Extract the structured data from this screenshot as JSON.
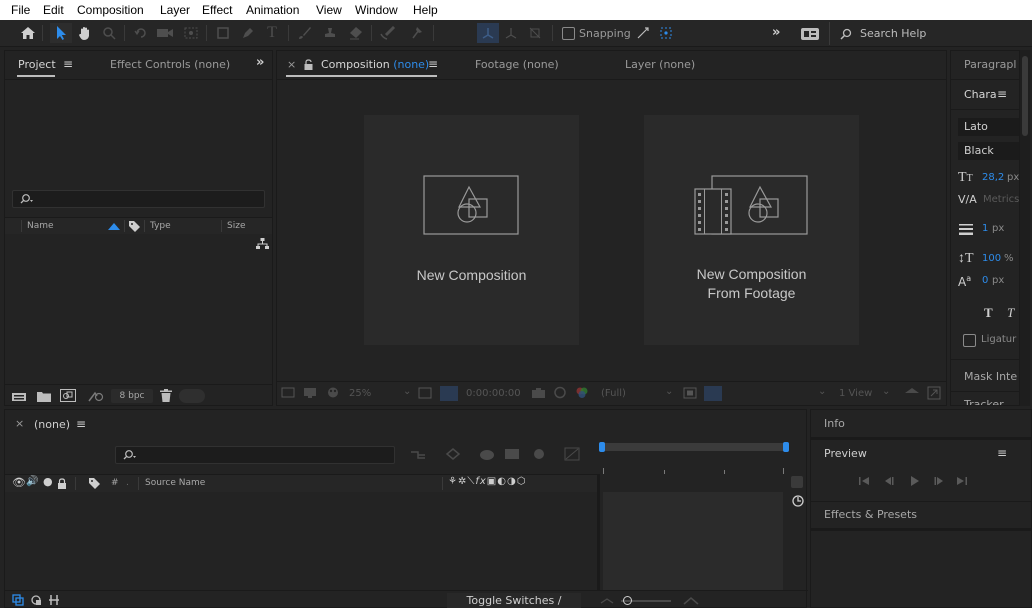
{
  "menu": [
    "File",
    "Edit",
    "Composition",
    "Layer",
    "Effect",
    "Animation",
    "View",
    "Window",
    "Help"
  ],
  "toolbar": {
    "snapping_label": "Snapping",
    "search_placeholder": "Search Help"
  },
  "project_panel": {
    "tab_project": "Project",
    "tab_effect_controls": "Effect Controls (none)",
    "columns": [
      "Name",
      "Type",
      "Size"
    ],
    "bpc": "8 bpc"
  },
  "viewer": {
    "tab_composition": "Composition",
    "tab_composition_value": "(none)",
    "tab_footage": "Footage (none)",
    "tab_layer": "Layer (none)",
    "card_new_comp": "New Composition",
    "card_from_footage_line1": "New Composition",
    "card_from_footage_line2": "From Footage",
    "zoom": "25%",
    "timecode": "0:00:00:00",
    "resolution": "(Full)",
    "views": "1 View"
  },
  "character_panel": {
    "tab_paragraph": "Paragrapl",
    "tab_character": "Chara",
    "font_family": "Lato",
    "font_style": "Black",
    "font_size": "28,2",
    "font_size_unit": "px",
    "kerning": "Metrics",
    "stroke_width": "1",
    "stroke_unit": "px",
    "vert_scale": "100",
    "vert_scale_unit": "%",
    "baseline_shift": "0",
    "baseline_unit": "px",
    "ligatures": "Ligatur",
    "mask_interp": "Mask Inte",
    "tracker": "Tracker"
  },
  "timeline": {
    "tab_label": "(none)",
    "col_source_name": "Source Name",
    "col_hash": "#",
    "toggle_label": "Toggle Switches / Modes"
  },
  "right_panels": {
    "info": "Info",
    "preview": "Preview",
    "effects_presets": "Effects & Presets"
  },
  "colors": {
    "accent": "#2d8ceb",
    "panel_bg": "#232323",
    "card_bg": "#2a2a2a",
    "menubar_bg": "#ffffff"
  }
}
